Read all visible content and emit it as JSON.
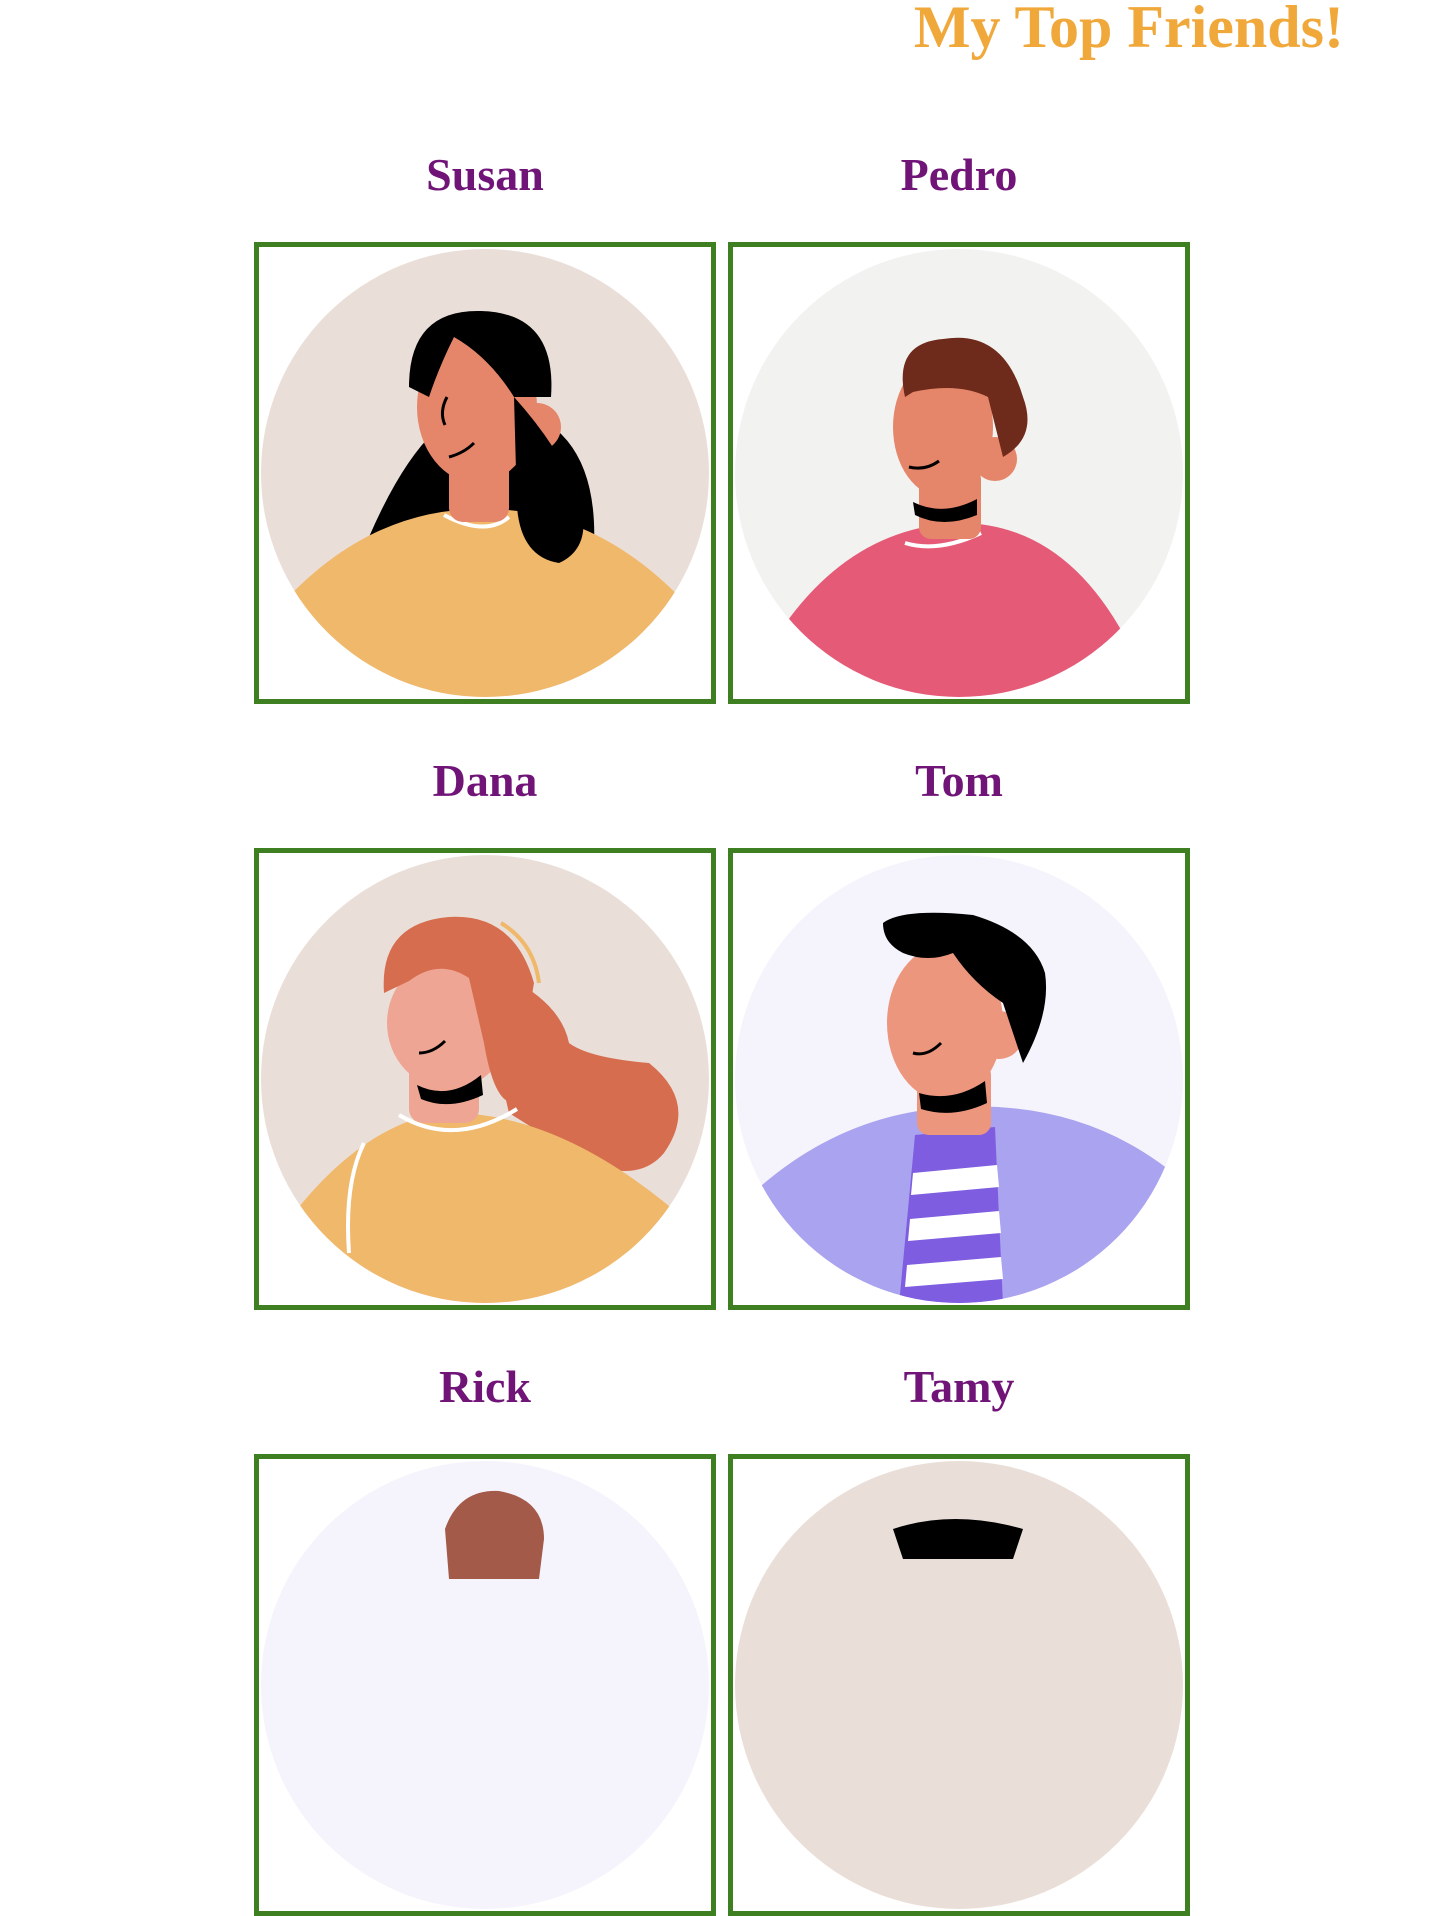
{
  "page": {
    "title": "My Top Friends!"
  },
  "friends": [
    {
      "name": "Susan"
    },
    {
      "name": "Pedro"
    },
    {
      "name": "Dana"
    },
    {
      "name": "Tom"
    },
    {
      "name": "Rick"
    },
    {
      "name": "Tamy"
    }
  ],
  "colors": {
    "title": "#f0a83a",
    "name": "#701477",
    "frame_border": "#3e7f22"
  }
}
